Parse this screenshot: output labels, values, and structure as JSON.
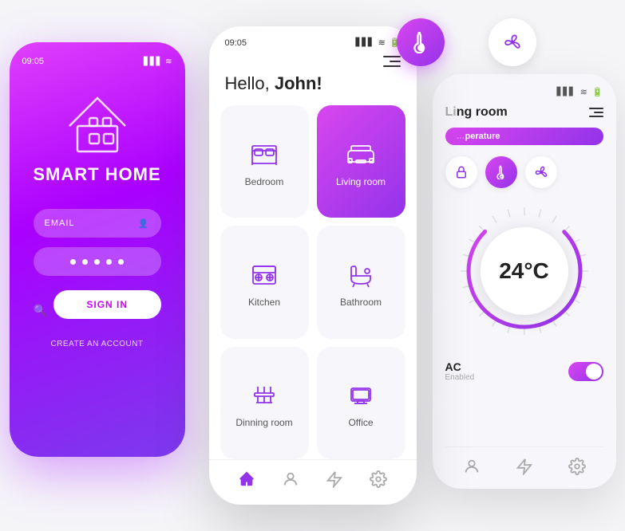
{
  "leftPhone": {
    "statusTime": "09:05",
    "title": "SMART HOME",
    "emailPlaceholder": "EMAIL",
    "signInLabel": "SIGN IN",
    "createLabel": "CREATE AN ACCOUNT"
  },
  "centerPhone": {
    "statusTime": "09:05",
    "greeting": "Hello, ",
    "userName": "John!",
    "rooms": [
      {
        "id": "bedroom",
        "name": "Bedroom",
        "active": false
      },
      {
        "id": "living",
        "name": "Living room",
        "active": true
      },
      {
        "id": "kitchen",
        "name": "Kitchen",
        "active": false
      },
      {
        "id": "bathroom",
        "name": "Bathroom",
        "active": false
      },
      {
        "id": "dining",
        "name": "Dinning room",
        "active": false
      },
      {
        "id": "office",
        "name": "Office",
        "active": false
      }
    ]
  },
  "rightPhone": {
    "roomName": "Living room",
    "tabLabel": "Temperature",
    "temperature": "24°C",
    "acLabel": "AC",
    "acStatus": "Enabled"
  },
  "floatingThermo": {
    "label": "thermometer-icon"
  },
  "floatingFan": {
    "label": "fan-icon"
  }
}
